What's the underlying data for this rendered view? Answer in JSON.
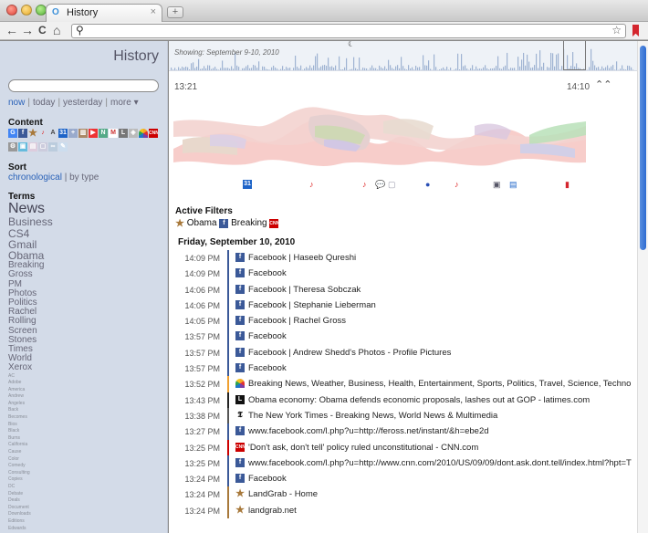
{
  "window": {
    "tab_title": "History",
    "tab_close": "×",
    "new_tab": "+"
  },
  "toolbar": {
    "back": "←",
    "forward": "→",
    "reload": "C",
    "home": "⌂",
    "url": ""
  },
  "sidebar": {
    "title": "History",
    "search_value": "",
    "time_filters": {
      "now": "now",
      "today": "today",
      "yesterday": "yesterday",
      "more": "more ▾"
    },
    "content_heading": "Content",
    "content_icons": [
      "google-icon",
      "facebook-icon",
      "star-icon",
      "music-icon",
      "text-icon",
      "calendar-icon",
      "plus-icon",
      "books-icon",
      "youtube-icon",
      "news-icon",
      "mail-icon",
      "document-icon",
      "shield-icon",
      "nbc-icon",
      "cnn-icon",
      "gear-icon",
      "photo-icon",
      "chart-icon",
      "doc2-icon",
      "link-icon",
      "pen-icon"
    ],
    "sort_heading": "Sort",
    "sort_chronological": "chronological",
    "sort_by_type": "| by type",
    "terms_heading": "Terms",
    "terms_large": [
      "News"
    ],
    "terms_medium1": [
      "Business",
      "CS4",
      "Gmail",
      "Obama"
    ],
    "terms_medium2": [
      "Breaking",
      "Gross",
      "PM",
      "Photos",
      "Politics",
      "Rachel",
      "Rolling",
      "Screen",
      "Stones",
      "Times",
      "World",
      "Xerox"
    ],
    "terms_small": [
      "AC",
      "Adobe",
      "America",
      "Andrew",
      "Angeles",
      "Back",
      "Becomes",
      "Bios",
      "Black",
      "Burns",
      "California",
      "Cause",
      "Color",
      "Comedy",
      "Consulting",
      "Copies",
      "DC",
      "Debate",
      "Deals",
      "Document",
      "Downloads",
      "Editions",
      "Edwards"
    ]
  },
  "overview": {
    "showing": "Showing: September 9-10, 2010"
  },
  "main": {
    "time_left": "13:21",
    "time_right": "14:10",
    "collapse_icon": "⌃⌃",
    "active_filters_title": "Active Filters",
    "active_filters": [
      {
        "icon": "star-icon",
        "label": "Obama"
      },
      {
        "icon": "facebook-icon",
        "label": "Breaking"
      },
      {
        "icon": "cnn-icon",
        "label": ""
      }
    ],
    "date_heading": "Friday, September 10, 2010",
    "entries": [
      {
        "time": "14:09 PM",
        "icon": "facebook",
        "title": "Facebook | Haseeb Qureshi",
        "stripe": "#3b5998"
      },
      {
        "time": "14:09 PM",
        "icon": "facebook",
        "title": "Facebook",
        "stripe": "#3b5998"
      },
      {
        "time": "14:06 PM",
        "icon": "facebook",
        "title": "Facebook | Theresa Sobczak",
        "stripe": "#3b5998"
      },
      {
        "time": "14:06 PM",
        "icon": "facebook",
        "title": "Facebook | Stephanie Lieberman",
        "stripe": "#3b5998"
      },
      {
        "time": "14:05 PM",
        "icon": "facebook",
        "title": "Facebook | Rachel Gross",
        "stripe": "#3b5998"
      },
      {
        "time": "13:57 PM",
        "icon": "facebook",
        "title": "Facebook",
        "stripe": "#3b5998"
      },
      {
        "time": "13:57 PM",
        "icon": "facebook",
        "title": "Facebook | Andrew Shedd's Photos - Profile Pictures",
        "stripe": "#3b5998"
      },
      {
        "time": "13:57 PM",
        "icon": "facebook",
        "title": "Facebook",
        "stripe": "#3b5998"
      },
      {
        "time": "13:52 PM",
        "icon": "nbc",
        "title": "Breaking News, Weather, Business, Health, Entertainment, Sports, Politics, Travel, Science, Technology",
        "stripe": "#f0a030"
      },
      {
        "time": "13:43 PM",
        "icon": "latimes",
        "title": "Obama economy: Obama defends economic proposals, lashes out at GOP - latimes.com",
        "stripe": "#222222"
      },
      {
        "time": "13:38 PM",
        "icon": "nyt",
        "title": "The New York Times - Breaking News, World News & Multimedia",
        "stripe": "#555555"
      },
      {
        "time": "13:27 PM",
        "icon": "facebook",
        "title": "www.facebook.com/l.php?u=http://feross.net/instant/&h=ebe2d",
        "stripe": "#3b5998"
      },
      {
        "time": "13:25 PM",
        "icon": "cnn",
        "title": "'Don't ask, don't tell' policy ruled unconstitutional - CNN.com",
        "stripe": "#cc0000"
      },
      {
        "time": "13:25 PM",
        "icon": "facebook",
        "title": "www.facebook.com/l.php?u=http://www.cnn.com/2010/US/09/09/dont.ask.dont.tell/index.html?hpt=T",
        "stripe": "#3b5998"
      },
      {
        "time": "13:24 PM",
        "icon": "facebook",
        "title": "Facebook",
        "stripe": "#3b5998"
      },
      {
        "time": "13:24 PM",
        "icon": "star",
        "title": "LandGrab - Home",
        "stripe": "#a8793b"
      },
      {
        "time": "13:24 PM",
        "icon": "star",
        "title": "landgrab.net",
        "stripe": "#a8793b"
      }
    ]
  }
}
